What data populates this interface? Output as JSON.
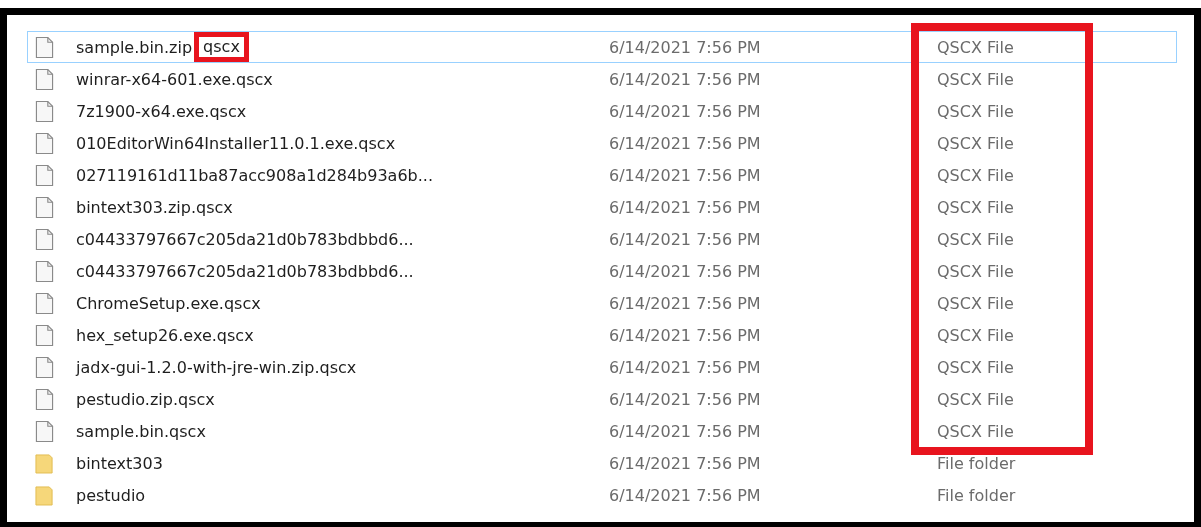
{
  "files": [
    {
      "name": "sample.bin.zip",
      "marked_suffix": "qscx",
      "date": "6/14/2021 7:56 PM",
      "type": "QSCX File",
      "kind": "file",
      "selected": true,
      "type_marked": true
    },
    {
      "name": "winrar-x64-601.exe.qscx",
      "date": "6/14/2021 7:56 PM",
      "type": "QSCX File",
      "kind": "file",
      "selected": false,
      "type_marked": true
    },
    {
      "name": "7z1900-x64.exe.qscx",
      "date": "6/14/2021 7:56 PM",
      "type": "QSCX File",
      "kind": "file",
      "selected": false,
      "type_marked": true
    },
    {
      "name": "010EditorWin64Installer11.0.1.exe.qscx",
      "date": "6/14/2021 7:56 PM",
      "type": "QSCX File",
      "kind": "file",
      "selected": false,
      "type_marked": true
    },
    {
      "name": "027119161d11ba87acc908a1d284b93a6b...",
      "date": "6/14/2021 7:56 PM",
      "type": "QSCX File",
      "kind": "file",
      "selected": false,
      "type_marked": true
    },
    {
      "name": "bintext303.zip.qscx",
      "date": "6/14/2021 7:56 PM",
      "type": "QSCX File",
      "kind": "file",
      "selected": false,
      "type_marked": true
    },
    {
      "name": "c04433797667c205da21d0b783bdbbd6...",
      "date": "6/14/2021 7:56 PM",
      "type": "QSCX File",
      "kind": "file",
      "selected": false,
      "type_marked": true
    },
    {
      "name": "c04433797667c205da21d0b783bdbbd6...",
      "date": "6/14/2021 7:56 PM",
      "type": "QSCX File",
      "kind": "file",
      "selected": false,
      "type_marked": true
    },
    {
      "name": "ChromeSetup.exe.qscx",
      "date": "6/14/2021 7:56 PM",
      "type": "QSCX File",
      "kind": "file",
      "selected": false,
      "type_marked": true
    },
    {
      "name": "hex_setup26.exe.qscx",
      "date": "6/14/2021 7:56 PM",
      "type": "QSCX File",
      "kind": "file",
      "selected": false,
      "type_marked": true
    },
    {
      "name": "jadx-gui-1.2.0-with-jre-win.zip.qscx",
      "date": "6/14/2021 7:56 PM",
      "type": "QSCX File",
      "kind": "file",
      "selected": false,
      "type_marked": true
    },
    {
      "name": "pestudio.zip.qscx",
      "date": "6/14/2021 7:56 PM",
      "type": "QSCX File",
      "kind": "file",
      "selected": false,
      "type_marked": true
    },
    {
      "name": "sample.bin.qscx",
      "date": "6/14/2021 7:56 PM",
      "type": "QSCX File",
      "kind": "file",
      "selected": false,
      "type_marked": true
    },
    {
      "name": "bintext303",
      "date": "6/14/2021 7:56 PM",
      "type": "File folder",
      "kind": "folder",
      "selected": false,
      "type_marked": false
    },
    {
      "name": "pestudio",
      "date": "6/14/2021 7:56 PM",
      "type": "File folder",
      "kind": "folder",
      "selected": false,
      "type_marked": false
    }
  ]
}
